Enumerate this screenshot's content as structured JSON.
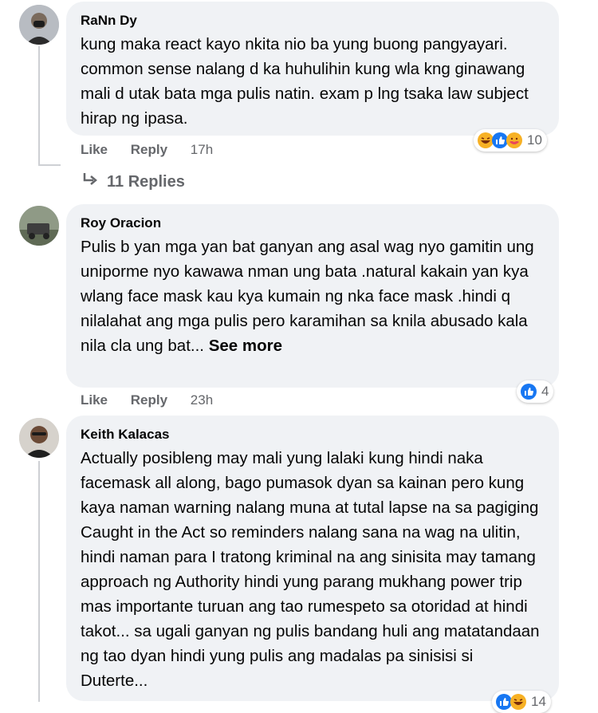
{
  "comments": [
    {
      "author": "RaNn Dy",
      "text": "kung maka react kayo nkita nio ba yung buong pangyayari. common sense nalang d ka huhulihin kung wla kng ginawang mali d utak bata mga pulis natin. exam p lng tsaka law subject hirap ng ipasa.",
      "like": "Like",
      "reply": "Reply",
      "time": "17h",
      "reaction_count": "10",
      "reactions": [
        "haha-icon",
        "like-icon",
        "care-icon"
      ]
    },
    {
      "author": "Roy Oracion",
      "text": "Pulis b yan mga yan bat ganyan ang asal wag nyo gamitin ung uniporme nyo kawawa nman ung bata .natural kakain yan kya wlang face mask kau kya kumain ng nka face mask .hindi q nilalahat ang mga pulis pero karamihan sa knila abusado kala nila cla ung bat...",
      "see_more": "See more",
      "like": "Like",
      "reply": "Reply",
      "time": "23h",
      "reaction_count": "4",
      "reactions": [
        "like-icon"
      ]
    },
    {
      "author": "Keith Kalacas",
      "text": "Actually posibleng may mali yung lalaki kung hindi naka facemask all along, bago pumasok dyan sa kainan pero kung kaya naman warning nalang muna at tutal lapse na sa pagiging Caught in the Act so reminders nalang sana na wag na ulitin, hindi naman para I tratong kriminal na ang sinisita may tamang approach ng Authority hindi yung parang mukhang power trip mas importante turuan ang tao rumespeto sa otoridad at hindi takot... sa ugali ganyan ng pulis bandang huli ang matatandaan ng tao dyan hindi yung pulis ang madalas pa sinisisi si Duterte...",
      "reaction_count": "14",
      "reactions": [
        "like-icon",
        "haha-icon"
      ]
    }
  ],
  "replies_link": {
    "label": "11 Replies"
  },
  "colors": {
    "bubble": "#f0f2f5",
    "like_blue": "#1877f2",
    "haha_yellow": "#f7b125",
    "care_red": "#e9475a",
    "secondary_text": "#65676b"
  }
}
